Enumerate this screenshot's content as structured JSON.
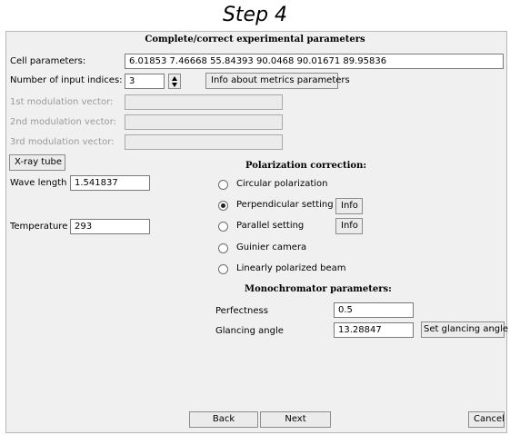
{
  "step_title": "Step 4",
  "heading": "Complete/correct experimental parameters",
  "cell": {
    "label": "Cell parameters:",
    "value": "6.01853 7.46668 55.84393 90.0468 90.01671 89.95836"
  },
  "indices": {
    "label": "Number of input indices:",
    "value": "3",
    "info_button": "Info about metrics parameters"
  },
  "modulation": [
    {
      "label": "1st modulation vector:",
      "value": ""
    },
    {
      "label": "2nd modulation vector:",
      "value": ""
    },
    {
      "label": "3rd modulation vector:",
      "value": ""
    }
  ],
  "xray_button": "X-ray tube",
  "wavelength": {
    "label": "Wave length",
    "value": "1.541837"
  },
  "temperature": {
    "label": "Temperature",
    "value": "293"
  },
  "polarization": {
    "heading": "Polarization correction:",
    "options": [
      {
        "label": "Circular polarization",
        "selected": false
      },
      {
        "label": "Perpendicular setting",
        "selected": true
      },
      {
        "label": "Parallel setting",
        "selected": false
      },
      {
        "label": "Guinier camera",
        "selected": false
      },
      {
        "label": "Linearly polarized beam",
        "selected": false
      }
    ],
    "info_label": "Info"
  },
  "monochromator": {
    "heading": "Monochromator parameters:",
    "perfectness": {
      "label": "Perfectness",
      "value": "0.5"
    },
    "glancing": {
      "label": "Glancing angle",
      "value": "13.28847",
      "button": "Set glancing angle"
    }
  },
  "footer": {
    "back": "Back",
    "next": "Next",
    "cancel": "Cancel"
  }
}
